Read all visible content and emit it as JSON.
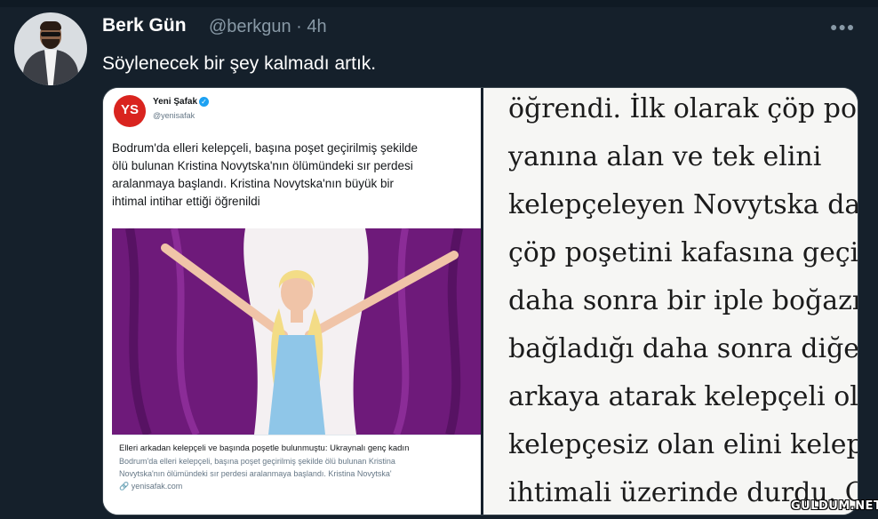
{
  "tweet": {
    "author_name": "Berk Gün",
    "author_handle_time": "@berkgun · 4h",
    "more_icon": "more-horizontal-icon",
    "text": "Söylenecek bir şey kalmadı artık."
  },
  "embedded_tweet": {
    "logo_text": "YS",
    "account_name": "Yeni Şafak",
    "verified_icon": "verified-badge-icon",
    "account_handle": "@yenisafak",
    "text_lines": [
      "Bodrum'da elleri kelepçeli, başına poşet geçirilmiş şekilde",
      "ölü bulunan Kristina Novytska'nın ölümündeki sır perdesi",
      "aralanmaya başlandı. Kristina Novytska'nın büyük bir",
      "ihtimal intihar ettiği öğrenildi"
    ],
    "card_title": "Elleri arkadan kelepçeli ve başında poşetle bulunmuştu: Ukraynalı genç kadın",
    "card_desc_lines": [
      "Bodrum'da elleri kelepçeli, başına poşet geçirilmiş şekilde ölü bulunan Kristina",
      "Novytska'nın ölümündeki sır perdesi aralanmaya başlandı. Kristina Novytska'"
    ],
    "card_domain": "yenisafak.com",
    "link_icon": "link-icon",
    "colors": {
      "logo_red": "#d9241f",
      "curtain_purple": "#7a1f86",
      "dress_blue": "#8fc6e8"
    }
  },
  "article_excerpt": {
    "lines": [
      "öğrendi. İlk olarak çöp po",
      "yanına alan ve tek elini",
      "kelepçeleyen Novytska da",
      "çöp poşetini kafasına geçi",
      "daha sonra bir iple boğazı",
      "bağladığı daha sonra diğer",
      "arkaya atarak kelepçeli ol",
      "kelepçesiz olan elini kelep",
      "ihtimali üzerinde durdu. O"
    ]
  },
  "watermark": "GULDUM.NET",
  "colors": {
    "background": "#15202b",
    "muted_text": "#8899a6"
  }
}
